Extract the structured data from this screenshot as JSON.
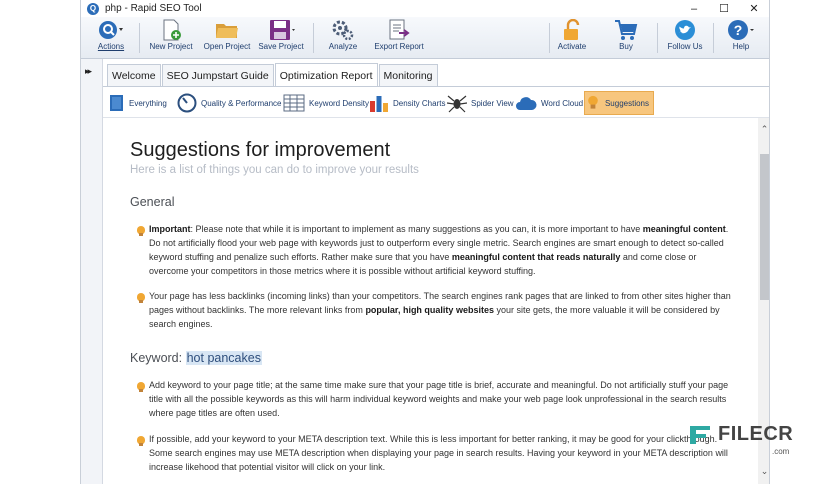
{
  "window": {
    "title": "php - Rapid SEO Tool",
    "app_icon": "magnifier-icon"
  },
  "toolbar": {
    "actions": "Actions",
    "new_project": "New Project",
    "open_project": "Open Project",
    "save_project": "Save Project",
    "analyze": "Analyze",
    "export_report": "Export Report",
    "activate": "Activate",
    "buy": "Buy",
    "follow_us": "Follow Us",
    "help": "Help"
  },
  "tabs": [
    "Welcome",
    "SEO Jumpstart Guide",
    "Optimization Report",
    "Monitoring"
  ],
  "active_tab": "Optimization Report",
  "subtabs": [
    "Everything",
    "Quality & Performance",
    "Keyword Density",
    "Density Charts",
    "Spider View",
    "Word Cloud",
    "Suggestions"
  ],
  "active_subtab": "Suggestions",
  "page": {
    "title": "Suggestions for improvement",
    "subtitle": "Here is a list of things you can do to improve your results",
    "general_heading": "General",
    "g1_strong1": "Important",
    "g1_t1": ": Please note that while it is important to implement as many suggestions as you can, it is more important to have ",
    "g1_strong2": "meaningful content",
    "g1_t2": ". Do not artificially flood your web page with keywords just to outperform every single metric. Search engines are smart enough to detect so-called keyword stuffing and penalize such efforts. Rather make sure that you have ",
    "g1_strong3": "meaningful content that reads naturally",
    "g1_t3": " and come close or overcome your competitors in those metrics where it is possible without artificial keyword stuffing.",
    "g2_t1": "Your page has less backlinks (incoming links) than your competitors. The search engines rank pages that are linked to from other sites higher than pages without backlinks. The more relevant links from ",
    "g2_strong1": "popular, high quality websites",
    "g2_t2": " your site gets, the more valuable it will be considered by search engines.",
    "keyword_label": "Keyword: ",
    "keyword": "hot pancakes",
    "k1": "Add keyword to your page title; at the same time make sure that your page title is brief, accurate and meaningful. Do not artificially stuff your page title with all the possible keywords as this will harm individual keyword weights and make your web page look unprofessional in the search results where page titles are often used.",
    "k2": "If possible, add your keyword to your META description text. While this is less important for better ranking, it may be good for your clickthrough. Some search engines may use META description when displaying your page in search results. Having your keyword in your META description will increase likehood that potential visitor will click on your link."
  },
  "watermark": {
    "brand": "FILECR",
    "domain": ".com"
  },
  "colors": {
    "accent": "#2b6cb8",
    "active_subtab": "#f7c67e",
    "bullet": "#f0a733",
    "keyword_highlight": "#d8e6f4"
  }
}
